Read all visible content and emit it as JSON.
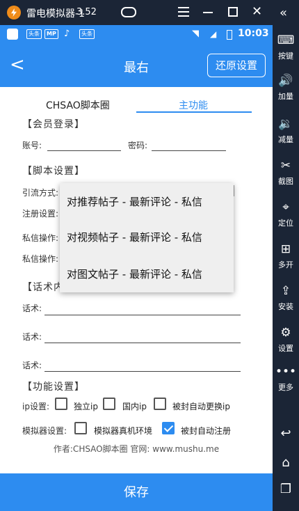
{
  "emulator": {
    "title": "雷电模拟器-1",
    "version": "3.52",
    "brand_color": "#f08c1a",
    "controls": [
      "menu-icon",
      "minimize-icon",
      "maximize-icon",
      "close-icon"
    ]
  },
  "toolbar": {
    "items": [
      {
        "label": "按键",
        "icon": "keyboard-icon"
      },
      {
        "label": "加量",
        "icon": "volume-up-icon"
      },
      {
        "label": "减量",
        "icon": "volume-down-icon"
      },
      {
        "label": "截图",
        "icon": "scissors-icon"
      },
      {
        "label": "定位",
        "icon": "location-icon"
      },
      {
        "label": "多开",
        "icon": "multi-instance-icon"
      },
      {
        "label": "安装",
        "icon": "apk-install-icon"
      },
      {
        "label": "设置",
        "icon": "gear-icon"
      },
      {
        "label": "更多",
        "icon": "more-icon"
      }
    ],
    "nav": [
      "back-icon",
      "home-icon",
      "recents-icon"
    ]
  },
  "statusbar": {
    "time": "10:03",
    "badges": [
      "头条",
      "头条"
    ]
  },
  "appbar": {
    "title": "最右",
    "restore_label": "还原设置",
    "accent": "#2d8cf0"
  },
  "tabs": [
    {
      "label": "CHSAO脚本圈",
      "active": false
    },
    {
      "label": "主功能",
      "active": true
    }
  ],
  "member": {
    "section": "【会员登录】",
    "account_label": "账号:",
    "password_label": "密码:"
  },
  "script": {
    "section": "【脚本设置】",
    "rows": [
      "引流方式:",
      "注册设置:",
      "私信操作:",
      "私信操作:"
    ]
  },
  "dropdown": {
    "options": [
      "对推荐帖子 - 最新评论 - 私信",
      "对视频帖子 - 最新评论 - 私信",
      "对图文帖子 - 最新评论 - 私信"
    ]
  },
  "talk": {
    "section": "【话术内",
    "label": "话术:"
  },
  "func": {
    "section": "【功能设置】",
    "ip_label": "ip设置:",
    "ip_options": [
      {
        "label": "独立ip",
        "checked": false
      },
      {
        "label": "国内ip",
        "checked": false
      },
      {
        "label": "被封自动更换ip",
        "checked": false
      }
    ],
    "emu_label": "模拟器设置:",
    "emu_options": [
      {
        "label": "模拟器真机环境",
        "checked": false
      },
      {
        "label": "被封自动注册",
        "checked": true
      }
    ]
  },
  "footer": {
    "author": "作者:CHSAO脚本圈 官网: www.mushu.me",
    "save_label": "保存"
  }
}
